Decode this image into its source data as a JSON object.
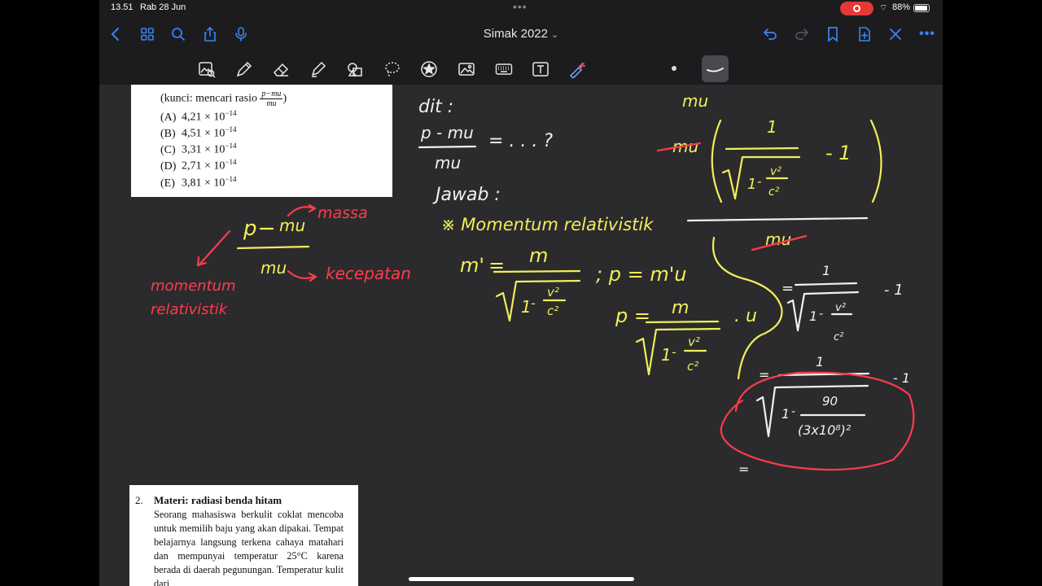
{
  "status_bar": {
    "time": "13.51",
    "date": "Rab 28 Jun",
    "battery": "88%"
  },
  "header": {
    "title": "Simak 2022",
    "left_icons": [
      "back-icon",
      "grid-icon",
      "search-icon",
      "share-icon",
      "mic-icon"
    ],
    "right_icons": [
      "undo-icon",
      "redo-icon",
      "bookmark-icon",
      "add-page-icon",
      "close-icon",
      "more-icon"
    ]
  },
  "toolbar": {
    "tools": [
      "image-scan-tool",
      "pen-tool",
      "eraser-tool",
      "highlighter-tool",
      "shapes-tool",
      "lasso-tool",
      "sticker-tool",
      "image-tool",
      "keyboard-tool",
      "text-tool",
      "laser-pointer-tool"
    ]
  },
  "question1": {
    "kunci_prefix": "(kunci: mencari rasio",
    "kunci_frac_num": "p−mu",
    "kunci_frac_den": "mu",
    "kunci_suffix": ")",
    "options": [
      {
        "label": "(A)",
        "value": "4,21 × 10",
        "exp": "−14"
      },
      {
        "label": "(B)",
        "value": "4,51 × 10",
        "exp": "−14"
      },
      {
        "label": "(C)",
        "value": "3,31 × 10",
        "exp": "−14"
      },
      {
        "label": "(D)",
        "value": "2,71 × 10",
        "exp": "−14"
      },
      {
        "label": "(E)",
        "value": "3,81 × 10",
        "exp": "−14"
      }
    ]
  },
  "question2": {
    "number": "2.",
    "heading": "Materi: radiasi benda hitam",
    "body": "Seorang mahasiswa berkulit coklat mencoba untuk memilih baju yang akan dipakai. Tempat belajarnya langsung terkena cahaya matahari dan mempunyai temperatur 25°C karena berada di daerah pegunungan. Temperatur kulit dari"
  },
  "handwriting": {
    "annot_p": "p",
    "annot_mu_top": "mu",
    "annot_mu_bottom": "mu",
    "annot_massa": "massa",
    "annot_kecepatan": "kecepatan",
    "annot_momentum": "momentum",
    "annot_relativistik": "relativistik",
    "dit": "dit :",
    "dit_num": "p - mu",
    "dit_den": "mu",
    "dit_eq": "= . . . ?",
    "jawab": "Jawab :",
    "momentum_heading": "※ Momentum relativistik",
    "m_prime": "m'",
    "eq": "=",
    "m_num": "m",
    "one": "1",
    "v2": "v²",
    "c2": "c²",
    "p_eq_mv": "; p = m'u",
    "p_lhs": "p =",
    "times_u": ". u",
    "mu_top_right": "mu",
    "mu_struck": "mu",
    "minus_one": "- 1",
    "eq_frac": "=",
    "speed_value": "90",
    "denom_value": "(3x10⁸)²",
    "last_eq": "="
  }
}
